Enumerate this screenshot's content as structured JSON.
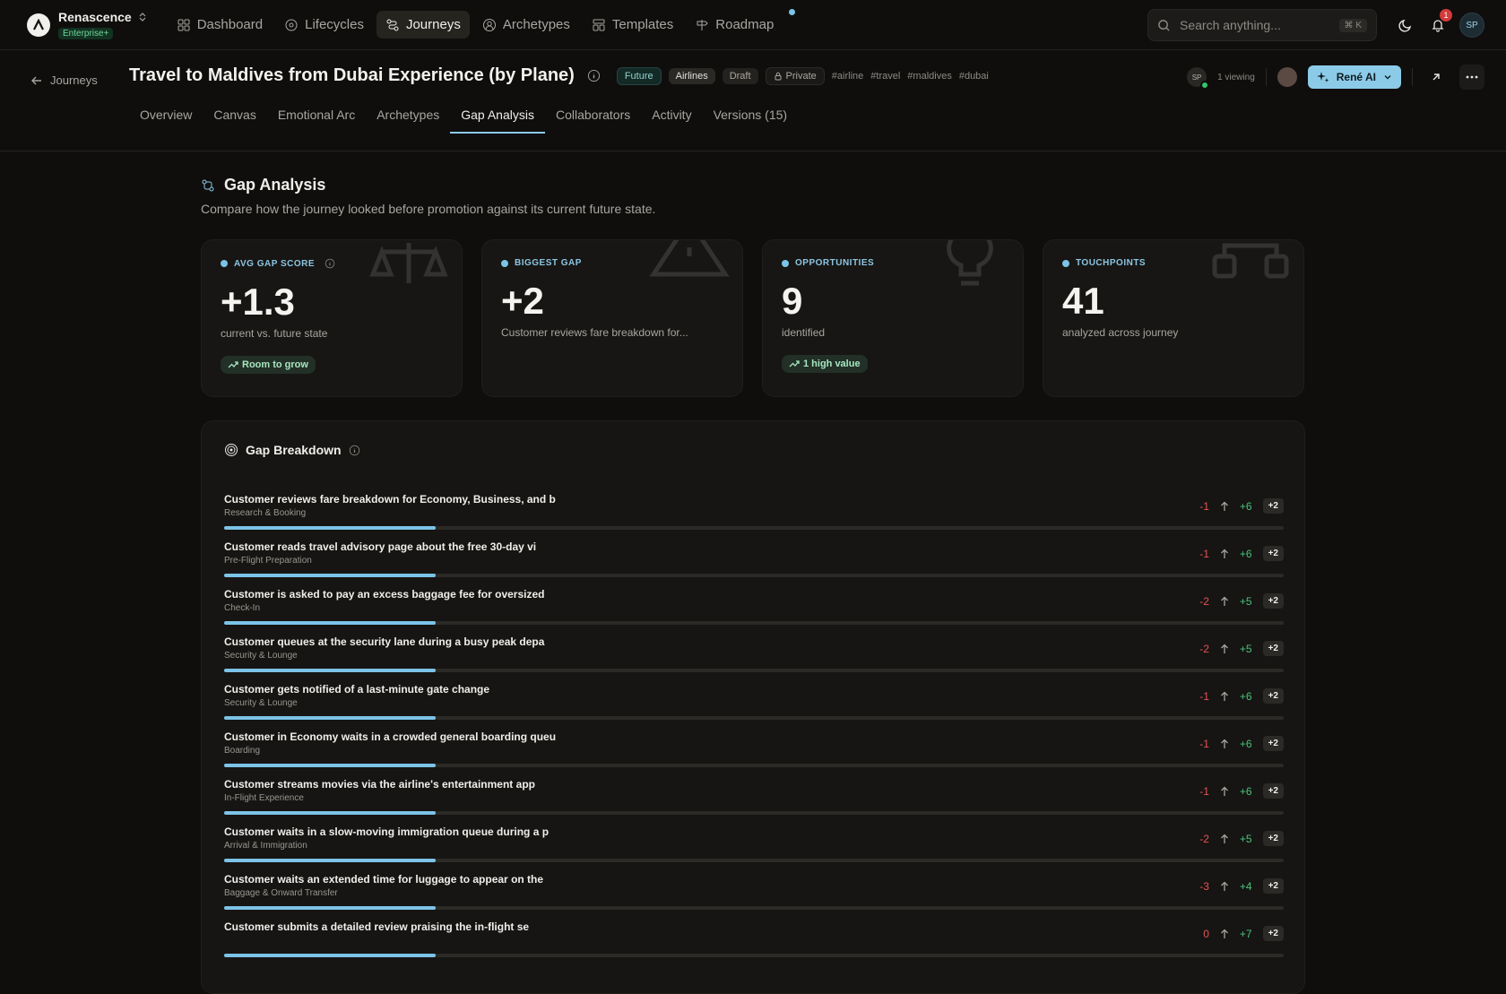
{
  "brand": {
    "name": "Renascence",
    "plan": "Enterprise+"
  },
  "nav": [
    {
      "label": "Dashboard",
      "icon": "grid-icon"
    },
    {
      "label": "Lifecycles",
      "icon": "cycle-icon"
    },
    {
      "label": "Journeys",
      "icon": "route-icon",
      "active": true
    },
    {
      "label": "Archetypes",
      "icon": "person-icon"
    },
    {
      "label": "Templates",
      "icon": "template-icon"
    },
    {
      "label": "Roadmap",
      "icon": "signpost-icon"
    }
  ],
  "search": {
    "placeholder": "Search anything...",
    "shortcut": "⌘ K"
  },
  "notifications": {
    "count": "1"
  },
  "user": {
    "initials": "SP"
  },
  "header": {
    "back_label": "Journeys",
    "title": "Travel to Maldives from Dubai Experience (by Plane)",
    "pills": {
      "future": "Future",
      "category": "Airlines",
      "status": "Draft",
      "visibility": "Private"
    },
    "tags": [
      "#airline",
      "#travel",
      "#maldives",
      "#dubai"
    ],
    "viewer_initials": "SP",
    "viewing": "1 viewing",
    "ai_button": "René AI"
  },
  "tabs": [
    "Overview",
    "Canvas",
    "Emotional Arc",
    "Archetypes",
    "Gap Analysis",
    "Collaborators",
    "Activity",
    "Versions (15)"
  ],
  "section": {
    "title": "Gap Analysis",
    "subtitle": "Compare how the journey looked before promotion against its current future state."
  },
  "cards": [
    {
      "label": "AVG GAP SCORE",
      "value": "+1.3",
      "sub": "current vs. future state",
      "chip": "Room to grow"
    },
    {
      "label": "BIGGEST GAP",
      "value": "+2",
      "sub": "Customer reviews fare breakdown for...",
      "chip": ""
    },
    {
      "label": "OPPORTUNITIES",
      "value": "9",
      "sub": "identified",
      "chip": "1 high value"
    },
    {
      "label": "TOUCHPOINTS",
      "value": "41",
      "sub": "analyzed across journey",
      "chip": ""
    }
  ],
  "breakdown": {
    "title": "Gap Breakdown",
    "rows": [
      {
        "title": "Customer reviews fare breakdown for Economy, Business, and b",
        "stage": "Research & Booking",
        "before": "-1",
        "after": "+6",
        "gap": "+2",
        "fill": 0.2
      },
      {
        "title": "Customer reads travel advisory page about the free 30-day vi",
        "stage": "Pre-Flight Preparation",
        "before": "-1",
        "after": "+6",
        "gap": "+2",
        "fill": 0.2
      },
      {
        "title": "Customer is asked to pay an excess baggage fee for oversized",
        "stage": "Check-In",
        "before": "-2",
        "after": "+5",
        "gap": "+2",
        "fill": 0.2
      },
      {
        "title": "Customer queues at the security lane during a busy peak depa",
        "stage": "Security & Lounge",
        "before": "-2",
        "after": "+5",
        "gap": "+2",
        "fill": 0.2
      },
      {
        "title": "Customer gets notified of a last-minute gate change",
        "stage": "Security & Lounge",
        "before": "-1",
        "after": "+6",
        "gap": "+2",
        "fill": 0.2
      },
      {
        "title": "Customer in Economy waits in a crowded general boarding queu",
        "stage": "Boarding",
        "before": "-1",
        "after": "+6",
        "gap": "+2",
        "fill": 0.2
      },
      {
        "title": "Customer streams movies via the airline's entertainment app",
        "stage": "In-Flight Experience",
        "before": "-1",
        "after": "+6",
        "gap": "+2",
        "fill": 0.2
      },
      {
        "title": "Customer waits in a slow-moving immigration queue during a p",
        "stage": "Arrival & Immigration",
        "before": "-2",
        "after": "+5",
        "gap": "+2",
        "fill": 0.2
      },
      {
        "title": "Customer waits an extended time for luggage to appear on the",
        "stage": "Baggage & Onward Transfer",
        "before": "-3",
        "after": "+4",
        "gap": "+2",
        "fill": 0.2
      },
      {
        "title": "Customer submits a detailed review praising the in-flight se",
        "stage": "",
        "before": "0",
        "after": "+7",
        "gap": "+2",
        "fill": 0.2
      }
    ]
  }
}
